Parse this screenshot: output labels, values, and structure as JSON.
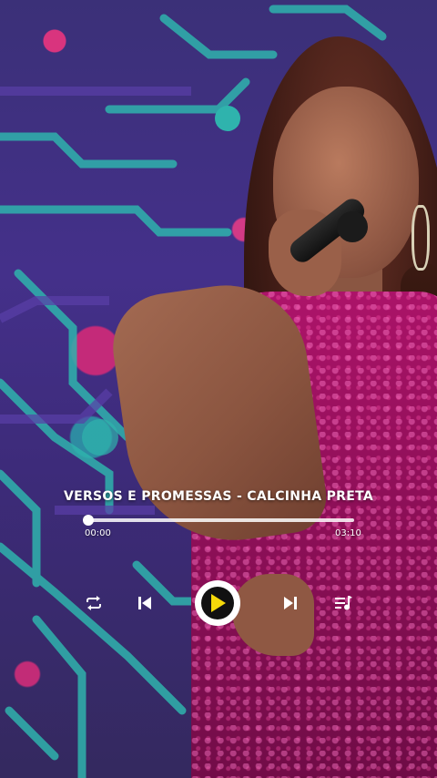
{
  "player": {
    "track_title": "VERSOS E PROMESSAS - CALCINHA PRETA",
    "current_time": "00:00",
    "duration": "03:10",
    "progress": 0.0,
    "state": "paused"
  },
  "controls": {
    "repeat_icon": "repeat-icon",
    "previous_icon": "skip-previous-icon",
    "play_icon": "play-icon",
    "next_icon": "skip-next-icon",
    "playlist_icon": "playlist-icon"
  },
  "colors": {
    "accent": "#f5d90a",
    "text": "#ffffff",
    "dress": "#a3125f",
    "circuit": "#27b4b2"
  }
}
